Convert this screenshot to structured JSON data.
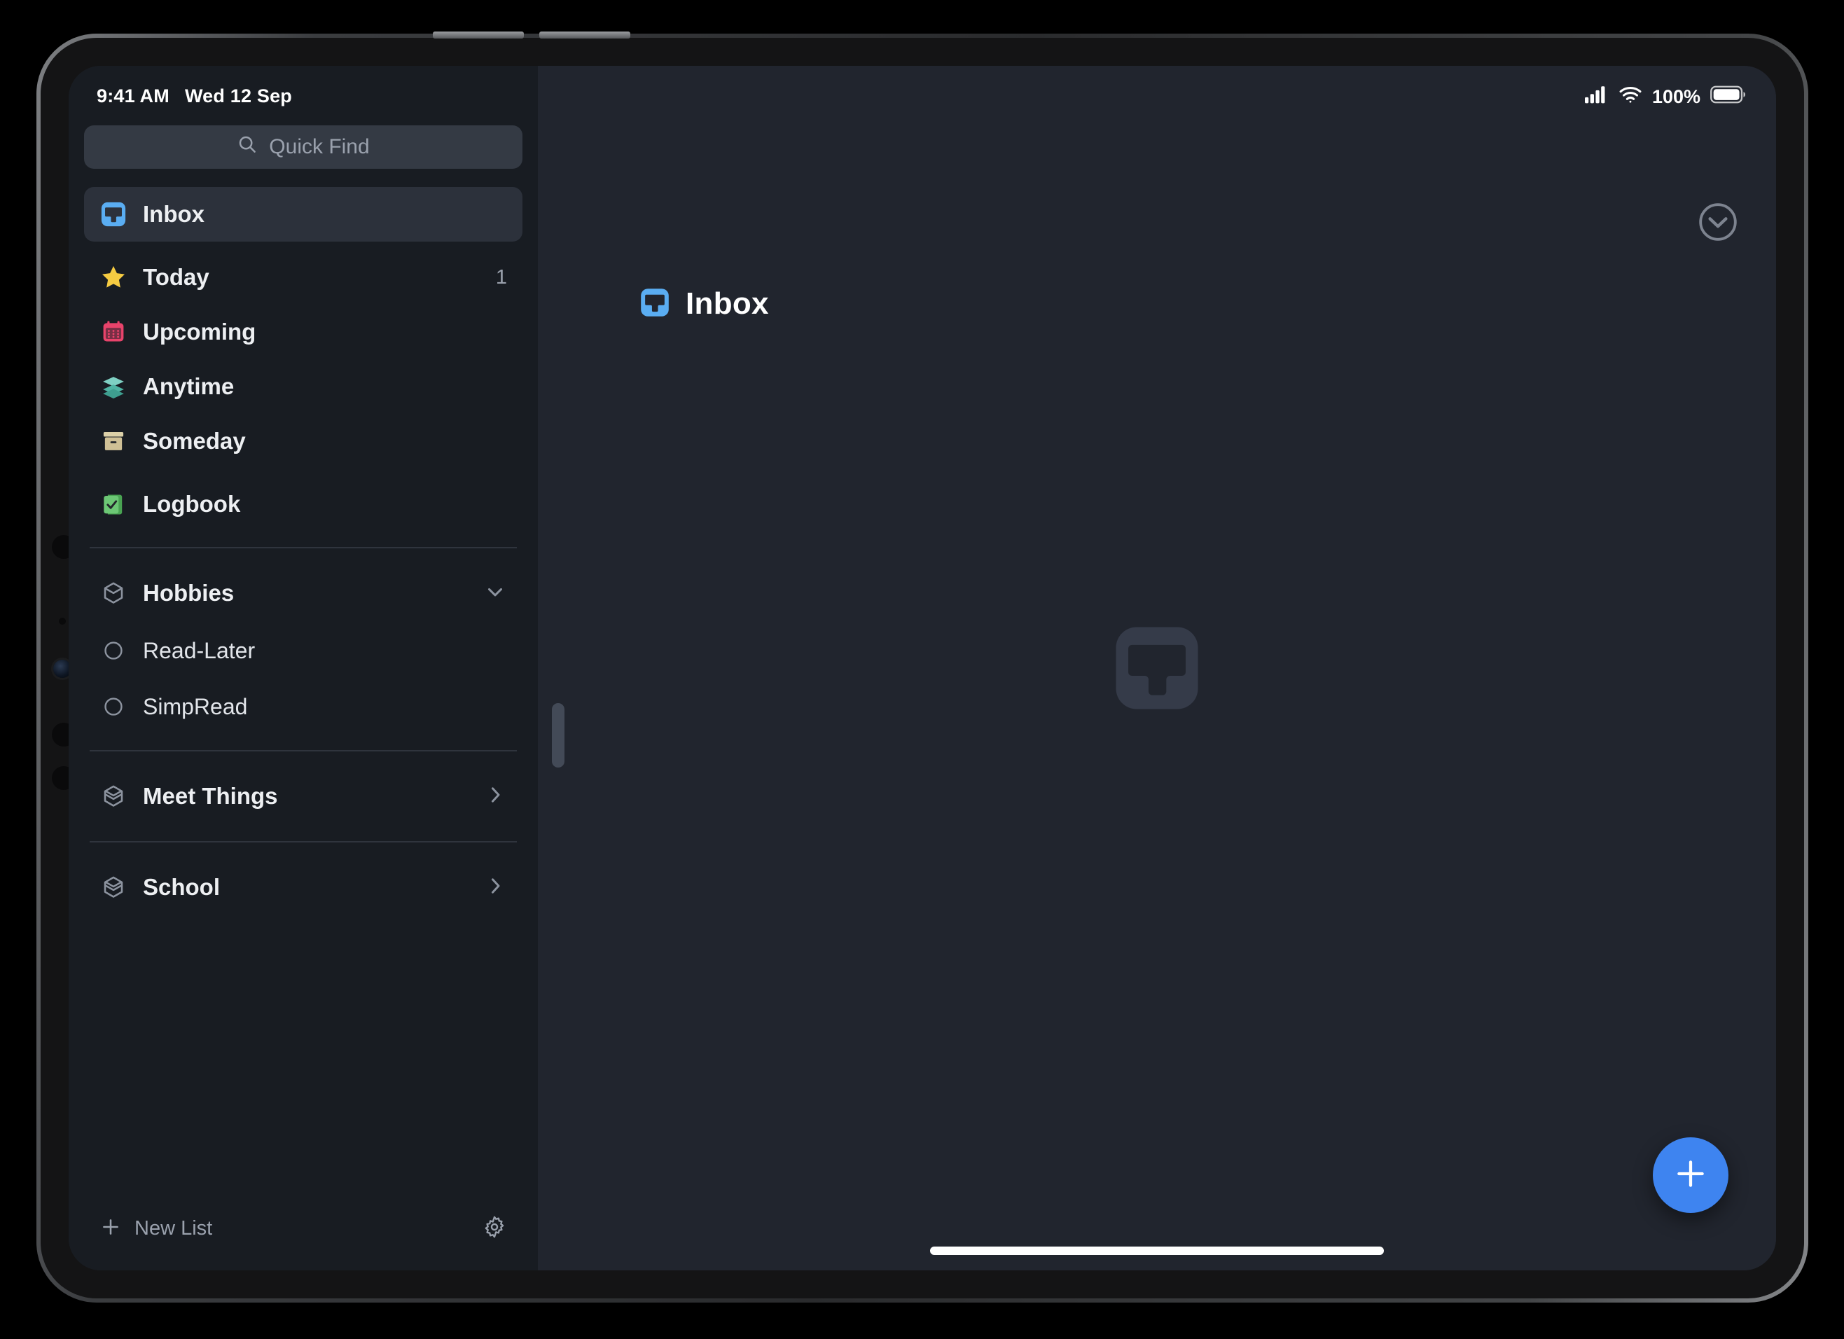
{
  "status_bar": {
    "time": "9:41 AM",
    "date": "Wed 12 Sep",
    "battery_percent": "100%",
    "cellular_icon": "cellular-bars-icon",
    "wifi_icon": "wifi-icon",
    "battery_icon": "battery-full-icon"
  },
  "search": {
    "placeholder": "Quick Find",
    "icon": "search-icon"
  },
  "sidebar": {
    "primary_items": [
      {
        "label": "Inbox",
        "icon": "inbox-icon",
        "count": "",
        "selected": true
      },
      {
        "label": "Today",
        "icon": "star-icon",
        "count": "1",
        "selected": false
      },
      {
        "label": "Upcoming",
        "icon": "calendar-icon",
        "count": "",
        "selected": false
      },
      {
        "label": "Anytime",
        "icon": "layers-icon",
        "count": "",
        "selected": false
      },
      {
        "label": "Someday",
        "icon": "archive-box-icon",
        "count": "",
        "selected": false
      },
      {
        "label": "Logbook",
        "icon": "logbook-icon",
        "count": "",
        "selected": false
      }
    ],
    "areas": [
      {
        "label": "Hobbies",
        "icon": "area-cube-icon",
        "expanded": true,
        "chevron": "chevron-down-icon",
        "projects": [
          {
            "label": "Read-Later",
            "icon": "project-circle-icon"
          },
          {
            "label": "SimpRead",
            "icon": "project-circle-icon"
          }
        ]
      },
      {
        "label": "Meet Things",
        "icon": "area-cube-icon",
        "expanded": false,
        "chevron": "chevron-right-icon",
        "projects": []
      },
      {
        "label": "School",
        "icon": "area-cube-icon",
        "expanded": false,
        "chevron": "chevron-right-icon",
        "projects": []
      }
    ],
    "footer": {
      "new_list_label": "New List",
      "new_list_icon": "plus-icon",
      "settings_icon": "gear-icon"
    }
  },
  "content": {
    "title": "Inbox",
    "title_icon": "inbox-icon",
    "collapse_icon": "chevron-down-circle-icon",
    "empty_watermark_icon": "inbox-watermark-icon",
    "add_button_icon": "plus-icon"
  },
  "colors": {
    "accent_blue": "#3E84F0",
    "inbox_blue": "#5AADF2",
    "today_yellow": "#F5CB42",
    "upcoming_pink": "#E8436B",
    "anytime_teal": "#5FC0B0",
    "someday_tan": "#D6C9A0",
    "logbook_green": "#5EC269",
    "sidebar_bg": "#181C22",
    "content_bg": "#21252E",
    "selected_row": "#2C313B",
    "search_field": "#343A44"
  }
}
